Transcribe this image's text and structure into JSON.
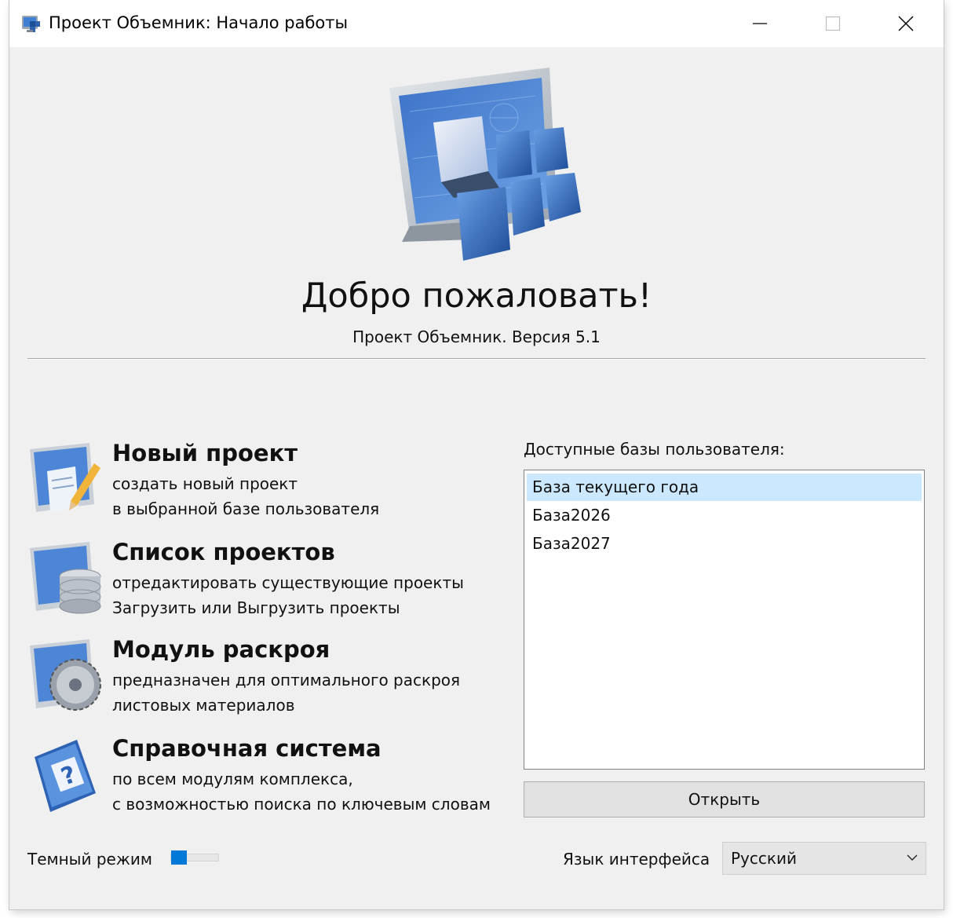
{
  "window": {
    "title": "Проект Объемник: Начало работы",
    "controls": {
      "minimize": "minimize-icon",
      "maximize": "maximize-icon",
      "close": "close-icon"
    }
  },
  "header": {
    "welcome": "Добро пожаловать!",
    "version": "Проект Объемник. Версия 5.1"
  },
  "menu": [
    {
      "icon": "new-project-icon",
      "title": "Новый проект",
      "line1": "создать новый проект",
      "line2": "в выбранной базе пользователя"
    },
    {
      "icon": "project-list-icon",
      "title": "Список проектов",
      "line1": "отредактировать существующие проекты",
      "line2": "Загрузить или Выгрузить проекты"
    },
    {
      "icon": "cutting-module-icon",
      "title": "Модуль раскроя",
      "line1": "предназначен для оптимального раскроя",
      "line2": "листовых материалов"
    },
    {
      "icon": "help-system-icon",
      "title": "Справочная система",
      "line1": "по всем модулям комплекса,",
      "line2": "с возможностью поиска по ключевым словам"
    }
  ],
  "databases": {
    "label": "Доступные базы пользователя:",
    "items": [
      "База текущего года",
      "База2026",
      "База2027"
    ],
    "selected_index": 0,
    "open_button": "Открыть"
  },
  "footer": {
    "dark_mode_label": "Темный режим",
    "dark_mode_on": false,
    "language_label": "Язык интерфейса",
    "language_value": "Русский"
  },
  "colors": {
    "window_bg": "#f0f0f0",
    "accent": "#0078d7",
    "selection": "#cce8ff"
  }
}
